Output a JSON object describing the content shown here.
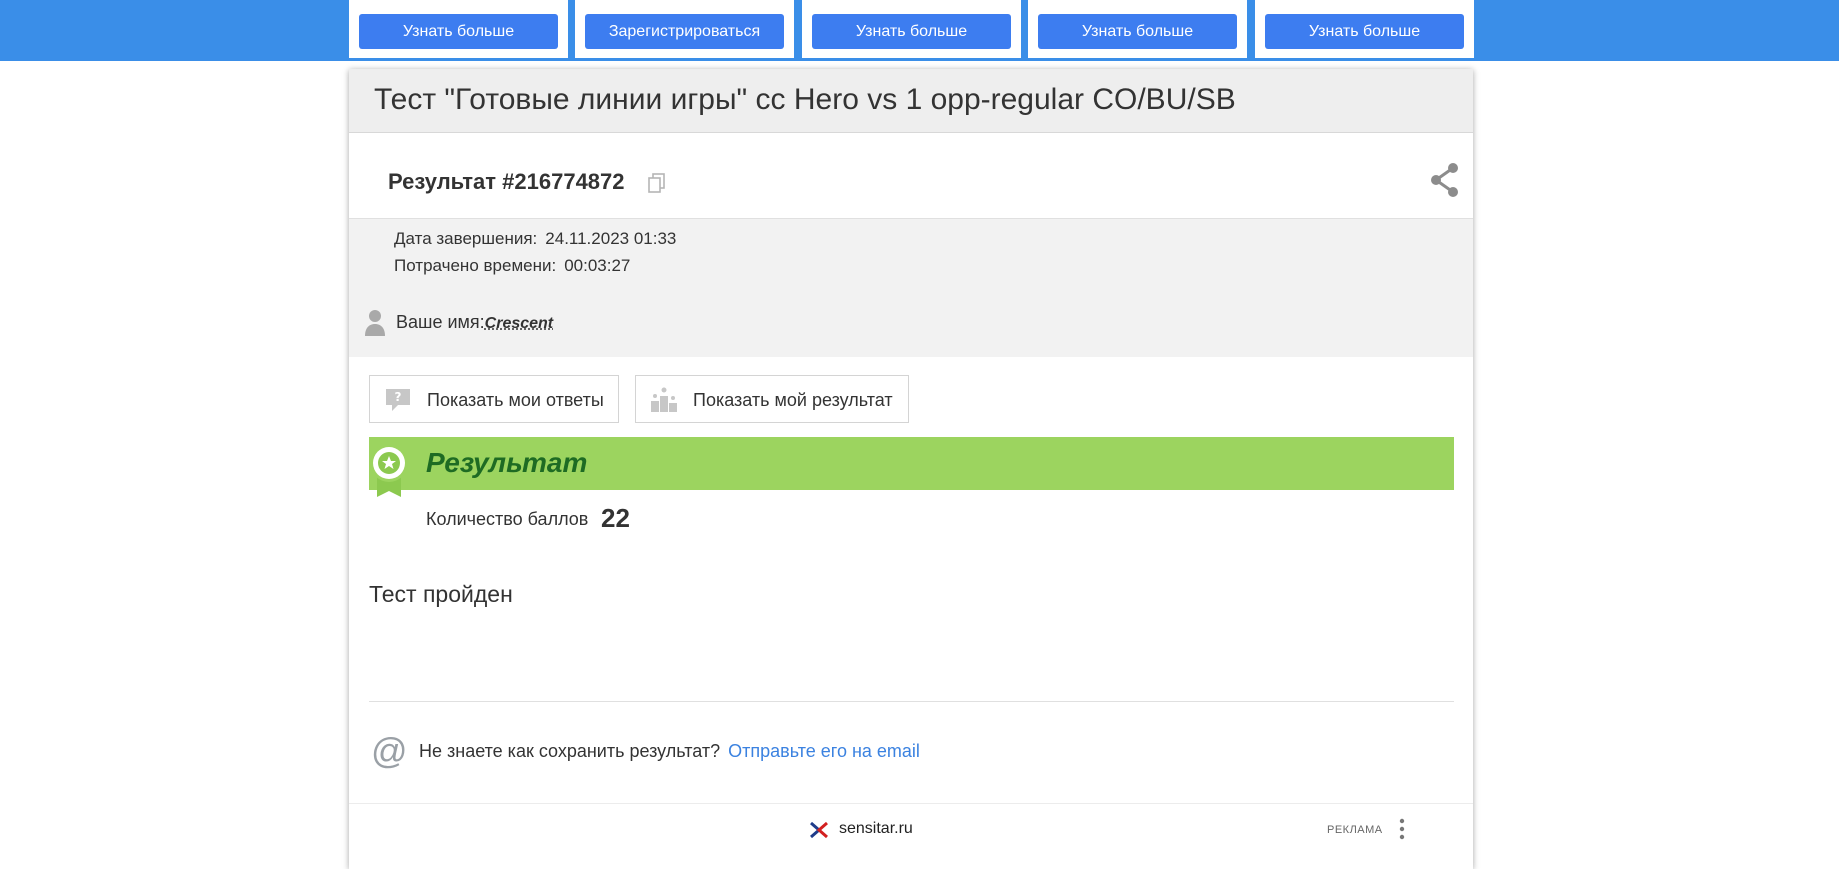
{
  "ads": {
    "buttons": [
      "Узнать больше",
      "Зарегистрироваться",
      "Узнать больше",
      "Узнать больше",
      "Узнать больше"
    ]
  },
  "test": {
    "title": "Тест \"Готовые линии игры\" сс Hero vs 1 opp-regular CO/BU/SB"
  },
  "result": {
    "number": "Результат #216774872",
    "finished_label": "Дата завершения:",
    "finished_value": "24.11.2023 01:33",
    "time_label": "Потрачено времени:",
    "time_value": "00:03:27",
    "name_label": "Ваше имя:",
    "name_value": "Crescent",
    "show_answers": "Показать мои ответы",
    "show_result": "Показать мой результат",
    "banner_title": "Результат",
    "score_label": "Количество баллов",
    "score_value": "22",
    "status": "Тест пройден"
  },
  "email": {
    "hint": "Не знаете как сохранить результат?",
    "link": "Отправьте его на email"
  },
  "footer_ad": {
    "site": "sensitar.ru",
    "tag": "РЕКЛАМА"
  },
  "colors": {
    "top_band": "#3a8ee8",
    "ad_button": "#3d7df0",
    "banner": "#9cd45f",
    "banner_text": "#1e6b23",
    "link": "#3b82e0"
  },
  "icons": [
    "copy-icon",
    "share-icon",
    "user-icon",
    "question-bubble-icon",
    "podium-icon",
    "medal-icon",
    "at-icon",
    "sensitar-logo",
    "more-vert-icon"
  ]
}
